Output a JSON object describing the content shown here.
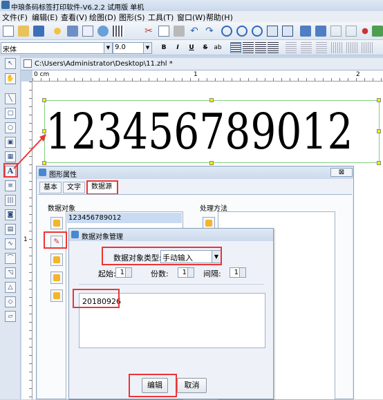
{
  "app": {
    "title": "中琅条码标签打印软件-V6.2.2 试用版 单机"
  },
  "menu": [
    "文件(F)",
    "编辑(E)",
    "查看(V)",
    "绘图(D)",
    "图形(S)",
    "工具(T)",
    "窗口(W)",
    "帮助(H)"
  ],
  "format_toolbar": {
    "font_name": "宋体",
    "font_size": "9.0",
    "bold": "B",
    "italic": "I",
    "underline": "U",
    "strike": "S"
  },
  "document": {
    "tab_path": "C:\\Users\\Administrator\\Desktop\\11.zhl *",
    "ruler_labels": [
      "0 cm",
      "1",
      "2"
    ],
    "ruler_v_label": "1",
    "barcode_text": "123456789012"
  },
  "shape_props_dialog": {
    "title": "图形属性",
    "tabs": [
      "基本",
      "文字",
      "数据源"
    ],
    "data_object_label": "数据对象",
    "data_object_item": "123456789012",
    "processing_label": "处理方法"
  },
  "data_mgmt_dialog": {
    "title": "数据对象管理",
    "type_label": "数据对象类型:",
    "type_value": "手动输入",
    "start_label": "起始:",
    "start_value": "1",
    "copies_label": "份数:",
    "copies_value": "1",
    "interval_label": "间隔:",
    "interval_value": "1",
    "content_value": "20180926",
    "edit_button": "编辑",
    "cancel_button": "取消"
  },
  "colors": {
    "highlight_red": "#e33333",
    "selection_green": "#7fd07f",
    "handle_yellow": "#ffea00"
  }
}
